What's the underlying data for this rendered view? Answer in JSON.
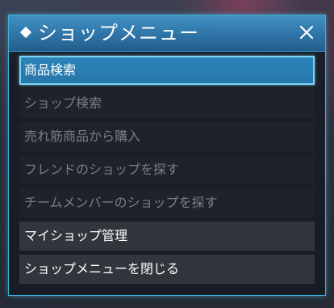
{
  "window": {
    "title": "ショップメニュー",
    "accent_color": "#3c8fc2",
    "icons": [
      "diamond-icon",
      "close-icon"
    ]
  },
  "menu": {
    "items": [
      {
        "label": "商品検索",
        "state": "selected"
      },
      {
        "label": "ショップ検索",
        "state": "disabled"
      },
      {
        "label": "売れ筋商品から購入",
        "state": "disabled"
      },
      {
        "label": "フレンドのショップを探す",
        "state": "disabled"
      },
      {
        "label": "チームメンバーのショップを探す",
        "state": "disabled"
      },
      {
        "label": "マイショップ管理",
        "state": "enabled"
      },
      {
        "label": "ショップメニューを閉じる",
        "state": "enabled"
      }
    ]
  }
}
